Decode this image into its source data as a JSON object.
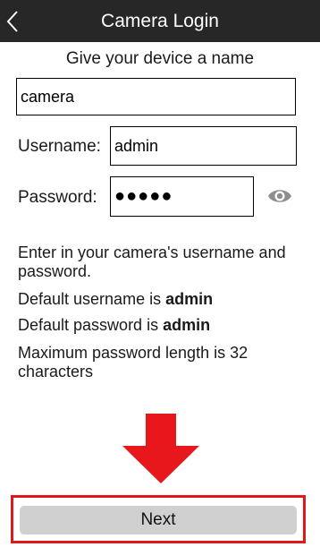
{
  "header": {
    "title": "Camera Login",
    "back_icon": "chevron-left-icon"
  },
  "form": {
    "name_prompt": "Give your device a name",
    "device_name_value": "camera",
    "username_label": "Username:",
    "username_value": "admin",
    "password_label": "Password:",
    "password_mask": "●●●●●",
    "show_password_icon": "eye-icon"
  },
  "info": {
    "line1": "Enter in your camera's username and password.",
    "line2_prefix": "Default username is ",
    "line2_value": "admin",
    "line3_prefix": "Default password is ",
    "line3_value": "admin",
    "line4": "Maximum password length is 32 characters"
  },
  "annotation": {
    "arrow_icon": "arrow-down-icon",
    "highlight_color": "#e0171b"
  },
  "footer": {
    "next_label": "Next"
  },
  "colors": {
    "nav_background": "#272727",
    "button_background": "#d0d0d0",
    "arrow_red": "#e8171b"
  }
}
